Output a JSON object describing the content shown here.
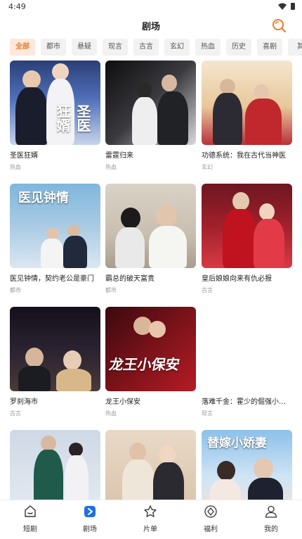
{
  "status": {
    "time": "4:49"
  },
  "header": {
    "title": "剧场",
    "search_icon": "search-icon"
  },
  "categories": [
    "全部",
    "都市",
    "悬疑",
    "现言",
    "古言",
    "玄幻",
    "热血",
    "历史",
    "喜剧",
    "其"
  ],
  "active_category": "全部",
  "cards": [
    {
      "title": "圣医狂婿",
      "tag": "热血",
      "poster_text": "圣医狂婿"
    },
    {
      "title": "雷霆归来",
      "tag": "热血",
      "poster_text": ""
    },
    {
      "title": "功德系统：我在古代当神医",
      "tag": "玄幻",
      "poster_text": ""
    },
    {
      "title": "医见钟情，契约老公是豪门",
      "tag": "都市",
      "poster_text": "医见钟情"
    },
    {
      "title": "霸总的破天富贵",
      "tag": "都市",
      "poster_text": ""
    },
    {
      "title": "皇后娘娘向来有仇必报",
      "tag": "古言",
      "poster_text": ""
    },
    {
      "title": "罗刹海市",
      "tag": "古言",
      "poster_text": ""
    },
    {
      "title": "龙王小保安",
      "tag": "热血",
      "poster_text": "龙王小保安"
    },
    {
      "title": "落难千金：霍少的倔强小娇妻",
      "tag": "现言",
      "poster_text": ""
    },
    {
      "title": "",
      "tag": "",
      "poster_text": ""
    },
    {
      "title": "",
      "tag": "",
      "poster_text": ""
    },
    {
      "title": "",
      "tag": "",
      "poster_text": "替嫁小娇妻"
    }
  ],
  "nav": [
    {
      "label": "短剧",
      "icon": "home-icon"
    },
    {
      "label": "剧场",
      "icon": "theater-icon"
    },
    {
      "label": "片单",
      "icon": "star-icon"
    },
    {
      "label": "福利",
      "icon": "gift-icon"
    },
    {
      "label": "我的",
      "icon": "profile-icon"
    }
  ],
  "colors": {
    "accent": "#f07a2a",
    "active_nav": "#1f6fe0"
  }
}
